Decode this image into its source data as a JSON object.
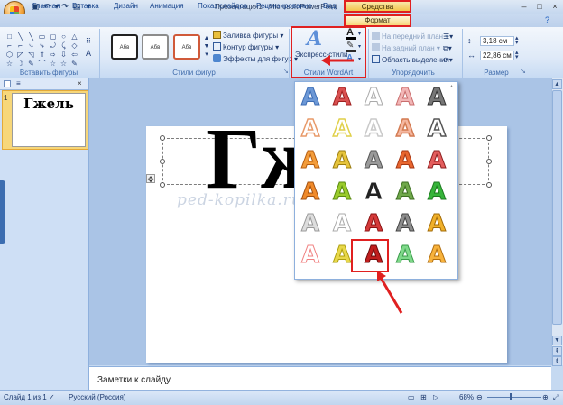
{
  "window": {
    "title": "Презентация1 - Microsoft PowerPoint",
    "context_tab_title": "Средства рисования"
  },
  "quick_access": {
    "save_icon": "save-icon",
    "undo_icon": "undo-icon",
    "redo_icon": "redo-icon"
  },
  "ribbon_tabs": [
    "Главная",
    "Вставка",
    "Дизайн",
    "Анимация",
    "Показ слайдов",
    "Рецензирование",
    "Вид",
    "Формат"
  ],
  "ribbon": {
    "insert_shapes_label": "Вставить фигуры",
    "shape_styles_label": "Стили фигур",
    "shape_style_sample": "Абв",
    "shape_fill": "Заливка фигуры",
    "shape_outline": "Контур фигуры",
    "shape_effects": "Эффекты для фигур",
    "wordart_quick_styles": "Экспресс-стили",
    "wordart_styles_label": "Стили WordArt",
    "bring_forward": "На передний план",
    "send_backward": "На задний план",
    "selection_pane": "Область выделения",
    "arrange_label": "Упорядочить",
    "height_value": "3,18 см",
    "width_value": "22,86 см",
    "size_label": "Размер"
  },
  "slide_panel": {
    "slide_number": "1",
    "thumbnail_text": "Гжель"
  },
  "slide": {
    "title_text": "Гж"
  },
  "watermark": "ped-kopilka.ru",
  "notes_placeholder": "Заметки к слайду",
  "status_bar": {
    "slide_info": "Слайд 1 из 1",
    "language": "Русский (Россия)",
    "zoom": "68%"
  },
  "gallery": {
    "letter": "A",
    "selected_row": 6,
    "selected_col": 3
  },
  "colors": {
    "highlight_red": "#e02020",
    "ribbon_blue": "#15428b",
    "slide_selected": "#f7d77a"
  }
}
